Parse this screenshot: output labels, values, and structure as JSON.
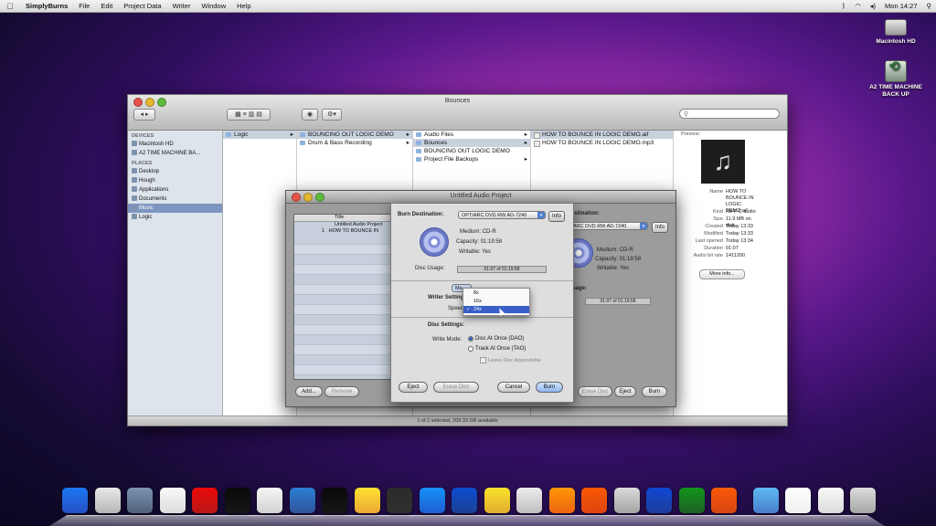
{
  "menubar": {
    "app": "SimplyBurns",
    "items": [
      "File",
      "Edit",
      "Project Data",
      "Writer",
      "Window",
      "Help"
    ],
    "clock": "Mon 14:27"
  },
  "desktop_icons": [
    {
      "label": "Macintosh HD"
    },
    {
      "label": "A2 TIME MACHINE BACK UP"
    }
  ],
  "finder": {
    "title": "Bounces",
    "sidebar": {
      "devices_header": "DEVICES",
      "devices": [
        "Macintosh HD",
        "A2 TIME MACHINE BA..."
      ],
      "places_header": "PLACES",
      "places": [
        "Desktop",
        "Hough",
        "Applications",
        "Documents",
        "Music",
        "Logic"
      ]
    },
    "col1": [
      "Logic"
    ],
    "col2": [
      "BOUNCING OUT LOGIC DEMO",
      "Drum & Bass Recording"
    ],
    "col3": [
      "Audio Files",
      "Bounces",
      "BOUNCING OUT LOGIC DEMO",
      "Project File Backups"
    ],
    "col4": [
      "HOW TO BOUNCE IN LOGIC DEMO.aif",
      "HOW TO BOUNCE IN LOGIC DEMO.mp3"
    ],
    "preview": {
      "header": "Preview:",
      "rows": [
        {
          "k": "Name",
          "v": "HOW TO BOUNCE IN LOGIC DEMO.aif"
        },
        {
          "k": "Kind",
          "v": "AIFF-C audio"
        },
        {
          "k": "Size",
          "v": "11.9 MB on disk"
        },
        {
          "k": "Created",
          "v": "Today 13:33"
        },
        {
          "k": "Modified",
          "v": "Today 13:33"
        },
        {
          "k": "Last opened",
          "v": "Today 13:34"
        },
        {
          "k": "Duration",
          "v": "01:07"
        },
        {
          "k": "Audio bit rate",
          "v": "1411200"
        }
      ],
      "more_info": "More info..."
    },
    "status": "1 of 2 selected, 209.33 GB available"
  },
  "project_window": {
    "title": "Untitled Audio Project",
    "list_header": "Title",
    "list_items": [
      "Untitled Audio Project",
      "HOW TO BOUNCE IN"
    ],
    "list_number": "1",
    "add": "Add...",
    "remove": "Remove",
    "destination_label": "Destination:",
    "destination_value": "ARC DVD RW AD-7240",
    "info": "Info",
    "medium_k": "Medium:",
    "medium_v": "CD-R",
    "capacity_k": "Capacity:",
    "capacity_v": "01:19:58",
    "writable_k": "Writable:",
    "writable_v": "Yes",
    "usage_label": "Usage:",
    "usage_value": "01:07 of 01:19:58",
    "erase": "Erase Disc",
    "eject": "Eject",
    "burn": "Burn"
  },
  "sheet": {
    "burn_destination_label": "Burn Destination:",
    "burn_destination_value": "OPTIARC DVD RW AD-7240",
    "info": "Info",
    "medium_k": "Medium:",
    "medium_v": "CD-R",
    "capacity_k": "Capacity:",
    "capacity_v": "01:19:58",
    "writable_k": "Writable:",
    "writable_v": "Yes",
    "usage_label": "Disc Usage:",
    "usage_value": "01:07 of 01:19:58",
    "mode_popup": "Ma",
    "writer_settings": "Writer Settings:",
    "speed_label": "Speed:",
    "disc_settings": "Disc Settings:",
    "write_mode_label": "Write Mode:",
    "dao": "Disc At Once (DAO)",
    "tao": "Track At Once (TAO)",
    "leave_appendable": "Leave Disc Appendable",
    "eject": "Eject",
    "erase": "Erase Disc",
    "cancel": "Cancel",
    "burn": "Burn"
  },
  "speed_menu": {
    "options": [
      "8x",
      "16x",
      "24x"
    ],
    "selected": "24x"
  },
  "dock": {
    "icons": [
      "finder-icon",
      "dashboard-icon",
      "mission-icon",
      "itunes-icon",
      "time-icon",
      "piano-icon",
      "printer-icon",
      "screen-icon",
      "clapper-icon",
      "logic-icon",
      "preview-icon",
      "itunes2-icon",
      "quicktime-icon",
      "burn-icon",
      "ipod-icon",
      "vlc-icon",
      "firefox-icon",
      "gift-icon",
      "word-icon",
      "excel-icon",
      "powerpoint-icon",
      "folder-icon",
      "docs-icon",
      "downloads-icon",
      "trash-icon"
    ],
    "colors": [
      "#3a7bd5",
      "#c9c9c9",
      "#7d8a9c",
      "#e5e5e5",
      "#cc2222",
      "#222222",
      "#dddddd",
      "#4a7fb5",
      "#222222",
      "#f0c050",
      "#4a4a4a",
      "#3388dd",
      "#2a63b0",
      "#e7c24a",
      "#cfcfcf",
      "#f28c1c",
      "#e66a18",
      "#bbbbbb",
      "#2d5fb5",
      "#2f8a3a",
      "#e26b1e",
      "#6ea0d8",
      "#f4f4f4",
      "#e4e4e4",
      "#bcbcbc"
    ]
  }
}
